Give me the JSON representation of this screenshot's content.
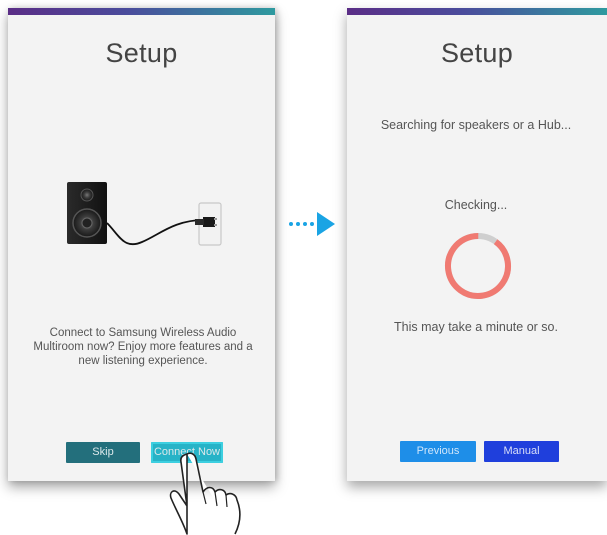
{
  "left_screen": {
    "title": "Setup",
    "description": "Connect to Samsung Wireless Audio Multiroom now? Enjoy more features and a new listening experience.",
    "buttons": {
      "skip": "Skip",
      "connect_now": "Connect Now"
    }
  },
  "right_screen": {
    "title": "Setup",
    "searching": "Searching for speakers or a Hub...",
    "checking": "Checking...",
    "wait_note": "This may take a minute or so.",
    "progress_fraction": 0.1,
    "buttons": {
      "previous": "Previous",
      "manual": "Manual"
    }
  },
  "icons": [
    "speaker-icon",
    "power-plug-icon",
    "arrow-right-icon",
    "hand-pointer-icon",
    "progress-ring-icon"
  ],
  "colors": {
    "skip_button": "#236f7c",
    "connect_button": "#27b3c7",
    "previous_button": "#1e8ee8",
    "manual_button": "#1f3fdc",
    "progress_ring": "#f07a72",
    "arrow": "#1aa4e4"
  }
}
